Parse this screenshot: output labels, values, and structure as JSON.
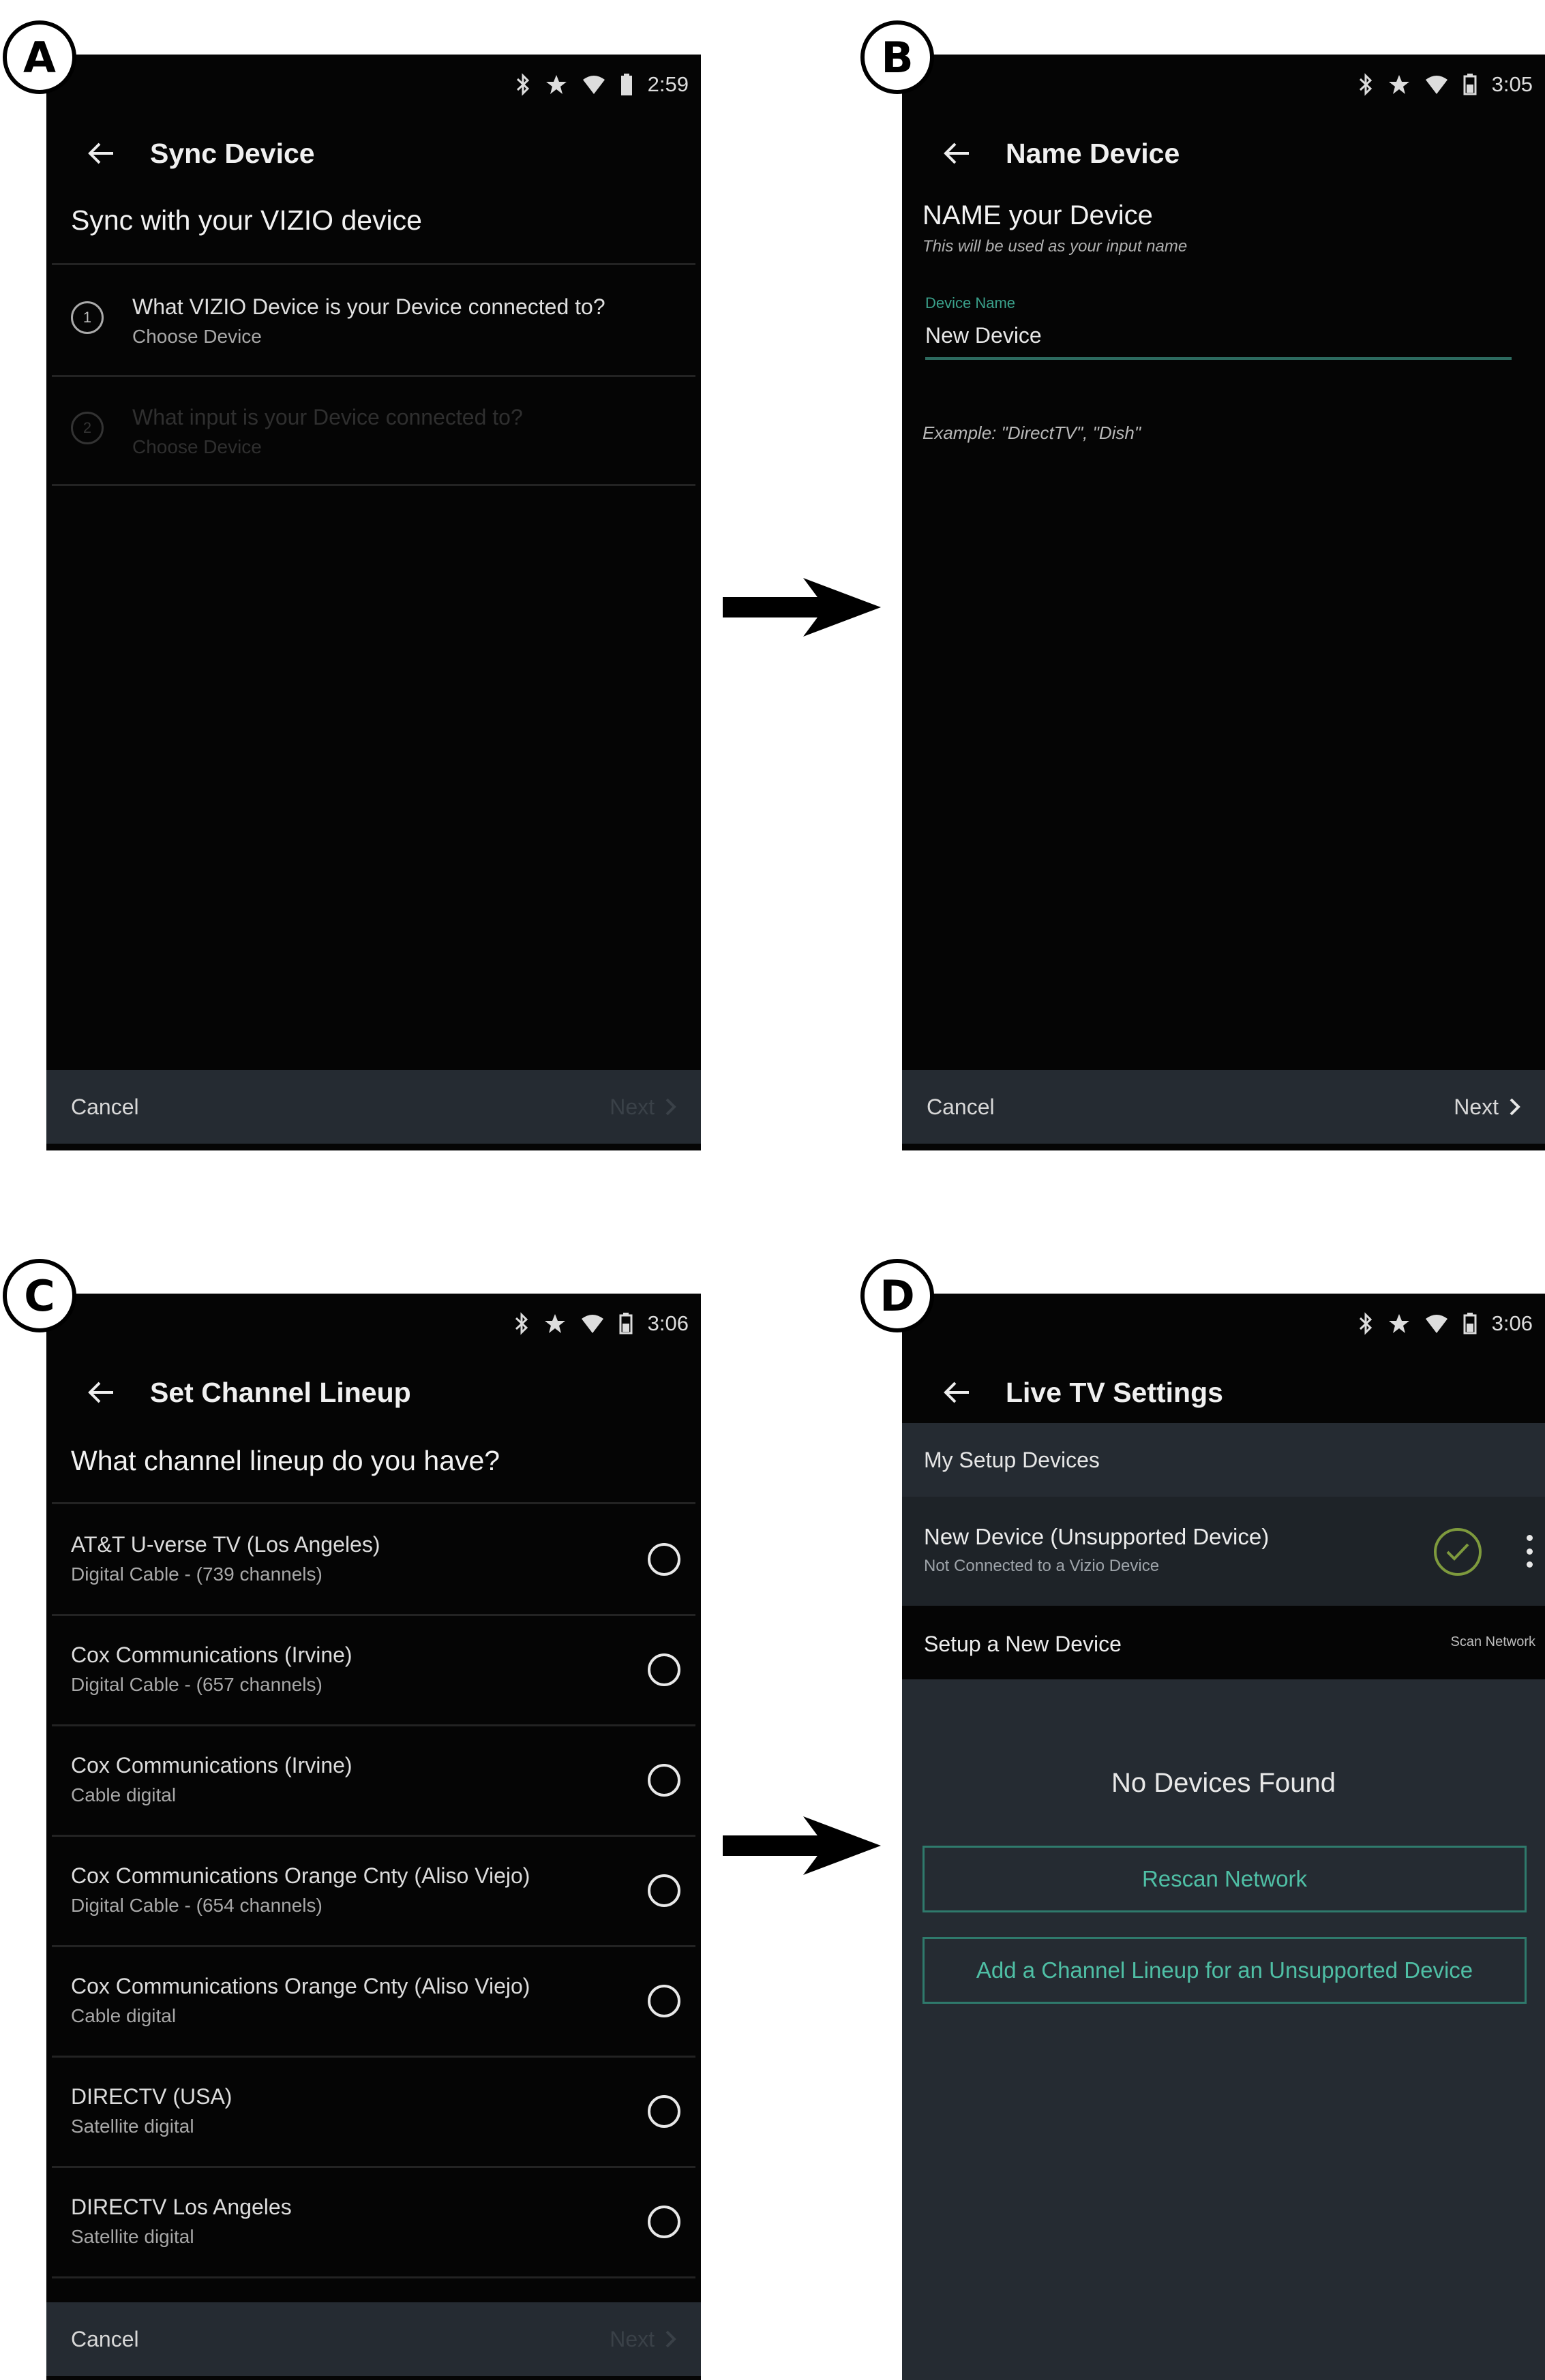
{
  "labels": {
    "a": "A",
    "b": "B",
    "c": "C",
    "d": "D"
  },
  "screenA": {
    "time": "2:59",
    "title": "Sync Device",
    "question": "Sync with your VIZIO device",
    "steps": [
      {
        "num": "1",
        "main": "What VIZIO Device is your Device connected to?",
        "sub": "Choose Device"
      },
      {
        "num": "2",
        "main": "What input is your Device connected to?",
        "sub": "Choose Device"
      }
    ],
    "cancel": "Cancel",
    "next": "Next"
  },
  "screenB": {
    "time": "3:05",
    "title": "Name Device",
    "heading": "NAME your Device",
    "help": "This will be used as your input name",
    "field_label": "Device Name",
    "field_value": "New Device",
    "example": "Example: \"DirectTV\", \"Dish\"",
    "cancel": "Cancel",
    "next": "Next"
  },
  "screenC": {
    "time": "3:06",
    "title": "Set Channel Lineup",
    "question": "What channel lineup do you have?",
    "options": [
      {
        "main": "AT&T U-verse TV (Los Angeles)",
        "sub": "Digital Cable - (739 channels)"
      },
      {
        "main": "Cox Communications (Irvine)",
        "sub": "Digital Cable - (657 channels)"
      },
      {
        "main": "Cox Communications (Irvine)",
        "sub": "Cable digital"
      },
      {
        "main": "Cox Communications Orange Cnty (Aliso Viejo)",
        "sub": "Digital Cable - (654 channels)"
      },
      {
        "main": "Cox Communications Orange Cnty (Aliso Viejo)",
        "sub": "Cable digital"
      },
      {
        "main": "DIRECTV (USA)",
        "sub": "Satellite digital"
      },
      {
        "main": "DIRECTV Los Angeles",
        "sub": "Satellite digital"
      }
    ],
    "cancel": "Cancel",
    "next": "Next"
  },
  "screenD": {
    "time": "3:06",
    "title": "Live TV Settings",
    "section": "My Setup Devices",
    "device_name": "New Device (Unsupported Device)",
    "device_status": "Not Connected to a Vizio Device",
    "setup_label": "Setup a New Device",
    "scan_label": "Scan Network",
    "no_devices": "No Devices Found",
    "rescan": "Rescan Network",
    "add_lineup": "Add a Channel Lineup for an Unsupported Device"
  }
}
